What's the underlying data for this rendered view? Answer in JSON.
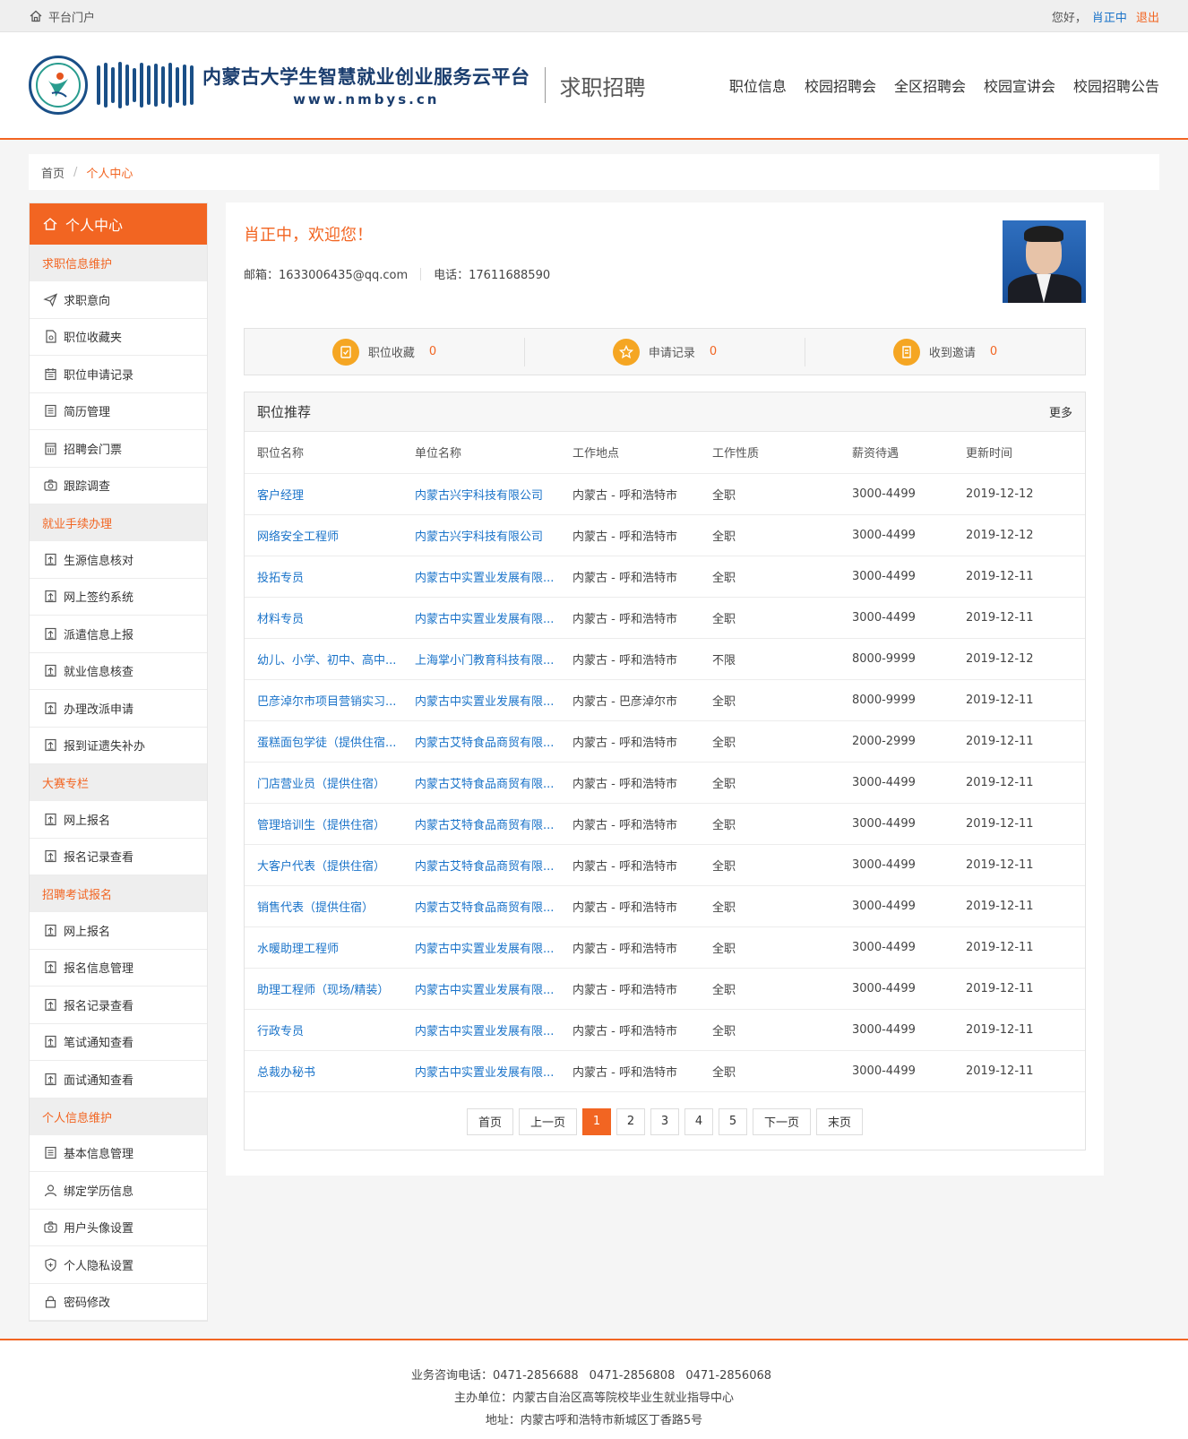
{
  "topbar": {
    "portal": "平台门户",
    "greeting": "您好，",
    "username": "肖正中",
    "logout": "退出"
  },
  "header": {
    "title": "内蒙古大学生智慧就业创业服务云平台",
    "url": "www.nmbys.cn",
    "subtitle": "求职招聘",
    "nav": [
      "职位信息",
      "校园招聘会",
      "全区招聘会",
      "校园宣讲会",
      "校园招聘公告"
    ]
  },
  "breadcrumb": {
    "home": "首页",
    "sep": "/",
    "current": "个人中心"
  },
  "sidebar": {
    "title": "个人中心",
    "groups": [
      {
        "label": "求职信息维护",
        "items": [
          {
            "label": "求职意向",
            "icon": "send-icon"
          },
          {
            "label": "职位收藏夹",
            "icon": "file-icon"
          },
          {
            "label": "职位申请记录",
            "icon": "calendar-icon"
          },
          {
            "label": "简历管理",
            "icon": "doc-icon"
          },
          {
            "label": "招聘会门票",
            "icon": "ticket-icon"
          },
          {
            "label": "跟踪调查",
            "icon": "camera-icon"
          }
        ]
      },
      {
        "label": "就业手续办理",
        "items": [
          {
            "label": "生源信息核对",
            "icon": "upload-icon"
          },
          {
            "label": "网上签约系统",
            "icon": "upload-icon"
          },
          {
            "label": "派遣信息上报",
            "icon": "upload-icon"
          },
          {
            "label": "就业信息核查",
            "icon": "upload-icon"
          },
          {
            "label": "办理改派申请",
            "icon": "upload-icon"
          },
          {
            "label": "报到证遗失补办",
            "icon": "upload-icon"
          }
        ]
      },
      {
        "label": "大赛专栏",
        "items": [
          {
            "label": "网上报名",
            "icon": "upload-icon"
          },
          {
            "label": "报名记录查看",
            "icon": "upload-icon"
          }
        ]
      },
      {
        "label": "招聘考试报名",
        "items": [
          {
            "label": "网上报名",
            "icon": "upload-icon"
          },
          {
            "label": "报名信息管理",
            "icon": "upload-icon"
          },
          {
            "label": "报名记录查看",
            "icon": "upload-icon"
          },
          {
            "label": "笔试通知查看",
            "icon": "upload-icon"
          },
          {
            "label": "面试通知查看",
            "icon": "upload-icon"
          }
        ]
      },
      {
        "label": "个人信息维护",
        "items": [
          {
            "label": "基本信息管理",
            "icon": "doc-icon"
          },
          {
            "label": "绑定学历信息",
            "icon": "user-icon"
          },
          {
            "label": "用户头像设置",
            "icon": "camera-icon"
          },
          {
            "label": "个人隐私设置",
            "icon": "shield-icon"
          },
          {
            "label": "密码修改",
            "icon": "lock-icon"
          }
        ]
      }
    ]
  },
  "profile": {
    "welcome": "肖正中，欢迎您！",
    "email": "邮箱：1633006435@qq.com",
    "phone": "电话：17611688590"
  },
  "stats": [
    {
      "label": "职位收藏",
      "count": "0",
      "icon": "check-doc-icon"
    },
    {
      "label": "申请记录",
      "count": "0",
      "icon": "star-icon"
    },
    {
      "label": "收到邀请",
      "count": "0",
      "icon": "invite-icon"
    }
  ],
  "recommend": {
    "title": "职位推荐",
    "more": "更多",
    "columns": [
      "职位名称",
      "单位名称",
      "工作地点",
      "工作性质",
      "薪资待遇",
      "更新时间"
    ],
    "rows": [
      [
        "客户经理",
        "内蒙古兴宇科技有限公司",
        "内蒙古 - 呼和浩特市",
        "全职",
        "3000-4499",
        "2019-12-12"
      ],
      [
        "网络安全工程师",
        "内蒙古兴宇科技有限公司",
        "内蒙古 - 呼和浩特市",
        "全职",
        "3000-4499",
        "2019-12-12"
      ],
      [
        "投拓专员",
        "内蒙古中实置业发展有限...",
        "内蒙古 - 呼和浩特市",
        "全职",
        "3000-4499",
        "2019-12-11"
      ],
      [
        "材料专员",
        "内蒙古中实置业发展有限...",
        "内蒙古 - 呼和浩特市",
        "全职",
        "3000-4499",
        "2019-12-11"
      ],
      [
        "幼儿、小学、初中、高中...",
        "上海掌小门教育科技有限...",
        "内蒙古 - 呼和浩特市",
        "不限",
        "8000-9999",
        "2019-12-12"
      ],
      [
        "巴彦淖尔市项目营销实习...",
        "内蒙古中实置业发展有限...",
        "内蒙古 - 巴彦淖尔市",
        "全职",
        "8000-9999",
        "2019-12-11"
      ],
      [
        "蛋糕面包学徒（提供住宿...",
        "内蒙古艾特食品商贸有限...",
        "内蒙古 - 呼和浩特市",
        "全职",
        "2000-2999",
        "2019-12-11"
      ],
      [
        "门店营业员（提供住宿）",
        "内蒙古艾特食品商贸有限...",
        "内蒙古 - 呼和浩特市",
        "全职",
        "3000-4499",
        "2019-12-11"
      ],
      [
        "管理培训生（提供住宿）",
        "内蒙古艾特食品商贸有限...",
        "内蒙古 - 呼和浩特市",
        "全职",
        "3000-4499",
        "2019-12-11"
      ],
      [
        "大客户代表（提供住宿）",
        "内蒙古艾特食品商贸有限...",
        "内蒙古 - 呼和浩特市",
        "全职",
        "3000-4499",
        "2019-12-11"
      ],
      [
        "销售代表（提供住宿）",
        "内蒙古艾特食品商贸有限...",
        "内蒙古 - 呼和浩特市",
        "全职",
        "3000-4499",
        "2019-12-11"
      ],
      [
        "水暖助理工程师",
        "内蒙古中实置业发展有限...",
        "内蒙古 - 呼和浩特市",
        "全职",
        "3000-4499",
        "2019-12-11"
      ],
      [
        "助理工程师（现场/精装）",
        "内蒙古中实置业发展有限...",
        "内蒙古 - 呼和浩特市",
        "全职",
        "3000-4499",
        "2019-12-11"
      ],
      [
        "行政专员",
        "内蒙古中实置业发展有限...",
        "内蒙古 - 呼和浩特市",
        "全职",
        "3000-4499",
        "2019-12-11"
      ],
      [
        "总裁办秘书",
        "内蒙古中实置业发展有限...",
        "内蒙古 - 呼和浩特市",
        "全职",
        "3000-4499",
        "2019-12-11"
      ]
    ]
  },
  "pager": {
    "first": "首页",
    "prev": "上一页",
    "pages": [
      "1",
      "2",
      "3",
      "4",
      "5"
    ],
    "active": "1",
    "next": "下一页",
    "last": "末页"
  },
  "footer": {
    "phones_label": "业务咨询电话：",
    "phones": [
      "0471-2856688",
      "0471-2856808",
      "0471-2856068"
    ],
    "sponsor": "主办单位：内蒙古自治区高等院校毕业生就业指导中心",
    "address": "地址：内蒙古呼和浩特市新城区丁香路5号"
  },
  "colors": {
    "accent": "#f26522",
    "link": "#1a73c9",
    "stat_icon": "#f5a623"
  }
}
